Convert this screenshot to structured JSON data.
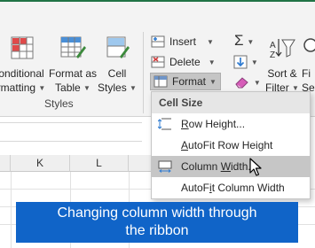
{
  "ribbon": {
    "styles_group": {
      "conditional": {
        "line1": "onditional",
        "line2": "rmatting"
      },
      "format_as_table": {
        "line1": "Format as",
        "line2": "Table"
      },
      "cell_styles": {
        "line1": "Cell",
        "line2": "Styles"
      },
      "group_label": "Styles"
    },
    "cells_group": {
      "insert": "Insert",
      "delete": "Delete",
      "format": "Format"
    },
    "editing_group": {
      "sort_filter": {
        "line1": "Sort &",
        "line2": "Filter"
      },
      "find_select": {
        "line1": "Fi",
        "line2": "Sel"
      }
    }
  },
  "format_menu": {
    "header": "Cell Size",
    "items": [
      {
        "pre": "",
        "mn": "R",
        "post": "ow Height...",
        "icon": "row-height-icon",
        "highlighted": false
      },
      {
        "pre": "",
        "mn": "A",
        "post": "utoFit Row Height",
        "icon": "",
        "highlighted": false
      },
      {
        "pre": "Column ",
        "mn": "W",
        "post": "idth...",
        "icon": "column-width-icon",
        "highlighted": true
      },
      {
        "pre": "AutoF",
        "mn": "i",
        "post": "t Column Width",
        "icon": "",
        "highlighted": false
      }
    ]
  },
  "sheet": {
    "columns": [
      "K",
      "L"
    ]
  },
  "callout": {
    "line1": "Changing column width through",
    "line2": "the ribbon"
  },
  "colors": {
    "callout_bg": "#1064c8",
    "excel_green": "#217346",
    "menu_highlight": "#c6c6c6"
  }
}
